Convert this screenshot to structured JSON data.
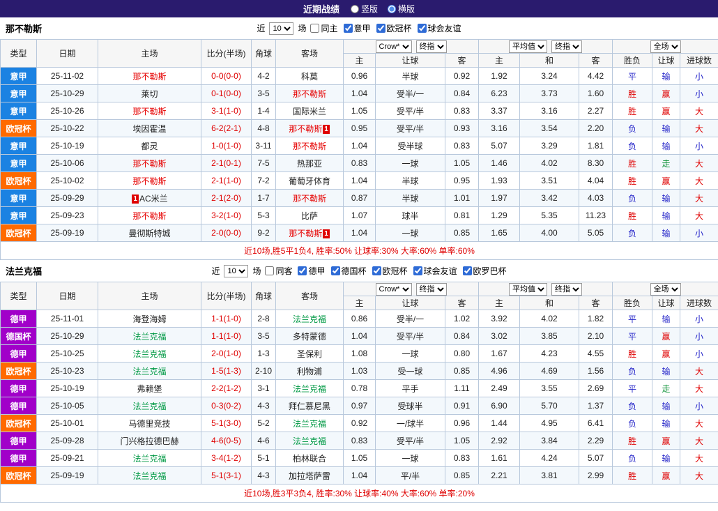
{
  "topbar": {
    "title": "近期战绩",
    "radios": [
      {
        "label": "竖版",
        "selected": false
      },
      {
        "label": "横版",
        "selected": true
      }
    ]
  },
  "header_controls": {
    "near": "近",
    "games": "10",
    "games_suffix": "场",
    "odds_source": "Crow*",
    "odds_kind": "终指",
    "avg": "平均值",
    "avg_kind": "终指",
    "scope": "全场"
  },
  "columns": {
    "type": "类型",
    "date": "日期",
    "home": "主场",
    "score": "比分(半场)",
    "corner": "角球",
    "away": "客场",
    "h": "主",
    "handicap": "让球",
    "a": "客",
    "h2": "主",
    "draw": "和",
    "a2": "客",
    "result": "胜负",
    "handicap2": "让球",
    "goals": "进球数"
  },
  "colors": {
    "topbar-bg": "#2A1B6E",
    "border": "#B8C8DC",
    "thead-bg": "#F6F6F6",
    "row-alt-bg": "#F3F8FC",
    "red": "#DF0000",
    "blue": "#2222C8",
    "green": "#089033"
  },
  "league_colors": {
    "意甲": "#1B82E2",
    "欧冠杯": "#FF6A00",
    "德甲": "#A100C9",
    "德国杯": "#A100C9"
  },
  "team_colors": {
    "那不勒斯": "#E60000",
    "法兰克福": "#009944"
  },
  "result_colors": {
    "胜": "red",
    "平": "blue",
    "负": "blue",
    "赢": "red",
    "输": "blue",
    "走": "green",
    "大": "red",
    "小": "blue"
  },
  "sections": [
    {
      "team": "那不勒斯",
      "filters": [
        {
          "label": "同主",
          "checked": false
        },
        {
          "label": "意甲",
          "checked": true
        },
        {
          "label": "欧冠杯",
          "checked": true
        },
        {
          "label": "球会友谊",
          "checked": true
        }
      ],
      "summary": "近10场,胜5平1负4, 胜率:50% 让球率:30% 大率:60% 单率:60%",
      "rows": [
        {
          "league": "意甲",
          "date": "25-11-02",
          "home": "那不勒斯",
          "score": "0-0(0-0)",
          "corner": "4-2",
          "away": "科莫",
          "odds_home": "0.96",
          "handicap": "半球",
          "odds_away": "0.92",
          "avg_home": "1.92",
          "avg_draw": "3.24",
          "avg_away": "4.42",
          "result": "平",
          "asian": "输",
          "goals": "小"
        },
        {
          "league": "意甲",
          "date": "25-10-29",
          "home": "莱切",
          "score": "0-1(0-0)",
          "corner": "3-5",
          "away": "那不勒斯",
          "odds_home": "1.04",
          "handicap": "受半/一",
          "odds_away": "0.84",
          "avg_home": "6.23",
          "avg_draw": "3.73",
          "avg_away": "1.60",
          "result": "胜",
          "asian": "赢",
          "goals": "小"
        },
        {
          "league": "意甲",
          "date": "25-10-26",
          "home": "那不勒斯",
          "score": "3-1(1-0)",
          "corner": "1-4",
          "away": "国际米兰",
          "odds_home": "1.05",
          "handicap": "受平/半",
          "odds_away": "0.83",
          "avg_home": "3.37",
          "avg_draw": "3.16",
          "avg_away": "2.27",
          "result": "胜",
          "asian": "赢",
          "goals": "大"
        },
        {
          "league": "欧冠杯",
          "date": "25-10-22",
          "home": "埃因霍温",
          "score": "6-2(2-1)",
          "corner": "4-8",
          "away": "那不勒斯",
          "away_card_post": "1",
          "odds_home": "0.95",
          "handicap": "受平/半",
          "odds_away": "0.93",
          "avg_home": "3.16",
          "avg_draw": "3.54",
          "avg_away": "2.20",
          "result": "负",
          "asian": "输",
          "goals": "大"
        },
        {
          "league": "意甲",
          "date": "25-10-19",
          "home": "都灵",
          "score": "1-0(1-0)",
          "corner": "3-11",
          "away": "那不勒斯",
          "odds_home": "1.04",
          "handicap": "受半球",
          "odds_away": "0.83",
          "avg_home": "5.07",
          "avg_draw": "3.29",
          "avg_away": "1.81",
          "result": "负",
          "asian": "输",
          "goals": "小"
        },
        {
          "league": "意甲",
          "date": "25-10-06",
          "home": "那不勒斯",
          "score": "2-1(0-1)",
          "corner": "7-5",
          "away": "热那亚",
          "odds_home": "0.83",
          "handicap": "一球",
          "odds_away": "1.05",
          "avg_home": "1.46",
          "avg_draw": "4.02",
          "avg_away": "8.30",
          "result": "胜",
          "asian": "走",
          "goals": "大"
        },
        {
          "league": "欧冠杯",
          "date": "25-10-02",
          "home": "那不勒斯",
          "score": "2-1(1-0)",
          "corner": "7-2",
          "away": "葡萄牙体育",
          "odds_home": "1.04",
          "handicap": "半球",
          "odds_away": "0.95",
          "avg_home": "1.93",
          "avg_draw": "3.51",
          "avg_away": "4.04",
          "result": "胜",
          "asian": "赢",
          "goals": "大"
        },
        {
          "league": "意甲",
          "date": "25-09-29",
          "home": "AC米兰",
          "home_card_pre": "1",
          "score": "2-1(2-0)",
          "corner": "1-7",
          "away": "那不勒斯",
          "odds_home": "0.87",
          "handicap": "半球",
          "odds_away": "1.01",
          "avg_home": "1.97",
          "avg_draw": "3.42",
          "avg_away": "4.03",
          "result": "负",
          "asian": "输",
          "goals": "大"
        },
        {
          "league": "意甲",
          "date": "25-09-23",
          "home": "那不勒斯",
          "score": "3-2(1-0)",
          "corner": "5-3",
          "away": "比萨",
          "odds_home": "1.07",
          "handicap": "球半",
          "odds_away": "0.81",
          "avg_home": "1.29",
          "avg_draw": "5.35",
          "avg_away": "11.23",
          "result": "胜",
          "asian": "输",
          "goals": "大"
        },
        {
          "league": "欧冠杯",
          "date": "25-09-19",
          "home": "曼彻斯特城",
          "score": "2-0(0-0)",
          "corner": "9-2",
          "away": "那不勒斯",
          "away_card_post": "1",
          "odds_home": "1.04",
          "handicap": "一球",
          "odds_away": "0.85",
          "avg_home": "1.65",
          "avg_draw": "4.00",
          "avg_away": "5.05",
          "result": "负",
          "asian": "输",
          "goals": "小"
        }
      ]
    },
    {
      "team": "法兰克福",
      "filters": [
        {
          "label": "同客",
          "checked": false
        },
        {
          "label": "德甲",
          "checked": true
        },
        {
          "label": "德国杯",
          "checked": true
        },
        {
          "label": "欧冠杯",
          "checked": true
        },
        {
          "label": "球会友谊",
          "checked": true
        },
        {
          "label": "欧罗巴杯",
          "checked": true
        }
      ],
      "summary": "近10场,胜3平3负4, 胜率:30% 让球率:40% 大率:60% 单率:20%",
      "rows": [
        {
          "league": "德甲",
          "date": "25-11-01",
          "home": "海登海姆",
          "score": "1-1(1-0)",
          "corner": "2-8",
          "away": "法兰克福",
          "odds_home": "0.86",
          "handicap": "受半/一",
          "odds_away": "1.02",
          "avg_home": "3.92",
          "avg_draw": "4.02",
          "avg_away": "1.82",
          "result": "平",
          "asian": "输",
          "goals": "小"
        },
        {
          "league": "德国杯",
          "date": "25-10-29",
          "home": "法兰克福",
          "score": "1-1(1-0)",
          "corner": "3-5",
          "away": "多特蒙德",
          "odds_home": "1.04",
          "handicap": "受平/半",
          "odds_away": "0.84",
          "avg_home": "3.02",
          "avg_draw": "3.85",
          "avg_away": "2.10",
          "result": "平",
          "asian": "赢",
          "goals": "小"
        },
        {
          "league": "德甲",
          "date": "25-10-25",
          "home": "法兰克福",
          "score": "2-0(1-0)",
          "corner": "1-3",
          "away": "圣保利",
          "odds_home": "1.08",
          "handicap": "一球",
          "odds_away": "0.80",
          "avg_home": "1.67",
          "avg_draw": "4.23",
          "avg_away": "4.55",
          "result": "胜",
          "asian": "赢",
          "goals": "小"
        },
        {
          "league": "欧冠杯",
          "date": "25-10-23",
          "home": "法兰克福",
          "score": "1-5(1-3)",
          "corner": "2-10",
          "away": "利物浦",
          "odds_home": "1.03",
          "handicap": "受一球",
          "odds_away": "0.85",
          "avg_home": "4.96",
          "avg_draw": "4.69",
          "avg_away": "1.56",
          "result": "负",
          "asian": "输",
          "goals": "大"
        },
        {
          "league": "德甲",
          "date": "25-10-19",
          "home": "弗赖堡",
          "score": "2-2(1-2)",
          "corner": "3-1",
          "away": "法兰克福",
          "odds_home": "0.78",
          "handicap": "平手",
          "odds_away": "1.11",
          "avg_home": "2.49",
          "avg_draw": "3.55",
          "avg_away": "2.69",
          "result": "平",
          "asian": "走",
          "goals": "大"
        },
        {
          "league": "德甲",
          "date": "25-10-05",
          "home": "法兰克福",
          "score": "0-3(0-2)",
          "corner": "4-3",
          "away": "拜仁慕尼黑",
          "odds_home": "0.97",
          "handicap": "受球半",
          "odds_away": "0.91",
          "avg_home": "6.90",
          "avg_draw": "5.70",
          "avg_away": "1.37",
          "result": "负",
          "asian": "输",
          "goals": "小"
        },
        {
          "league": "欧冠杯",
          "date": "25-10-01",
          "home": "马德里竞技",
          "score": "5-1(3-0)",
          "corner": "5-2",
          "away": "法兰克福",
          "odds_home": "0.92",
          "handicap": "一/球半",
          "odds_away": "0.96",
          "avg_home": "1.44",
          "avg_draw": "4.95",
          "avg_away": "6.41",
          "result": "负",
          "asian": "输",
          "goals": "大"
        },
        {
          "league": "德甲",
          "date": "25-09-28",
          "home": "门兴格拉德巴赫",
          "score": "4-6(0-5)",
          "corner": "4-6",
          "away": "法兰克福",
          "odds_home": "0.83",
          "handicap": "受平/半",
          "odds_away": "1.05",
          "avg_home": "2.92",
          "avg_draw": "3.84",
          "avg_away": "2.29",
          "result": "胜",
          "asian": "赢",
          "goals": "大"
        },
        {
          "league": "德甲",
          "date": "25-09-21",
          "home": "法兰克福",
          "score": "3-4(1-2)",
          "corner": "5-1",
          "away": "柏林联合",
          "odds_home": "1.05",
          "handicap": "一球",
          "odds_away": "0.83",
          "avg_home": "1.61",
          "avg_draw": "4.24",
          "avg_away": "5.07",
          "result": "负",
          "asian": "输",
          "goals": "大"
        },
        {
          "league": "欧冠杯",
          "date": "25-09-19",
          "home": "法兰克福",
          "score": "5-1(3-1)",
          "corner": "4-3",
          "away": "加拉塔萨雷",
          "odds_home": "1.04",
          "handicap": "平/半",
          "odds_away": "0.85",
          "avg_home": "2.21",
          "avg_draw": "3.81",
          "avg_away": "2.99",
          "result": "胜",
          "asian": "赢",
          "goals": "大"
        }
      ]
    }
  ]
}
